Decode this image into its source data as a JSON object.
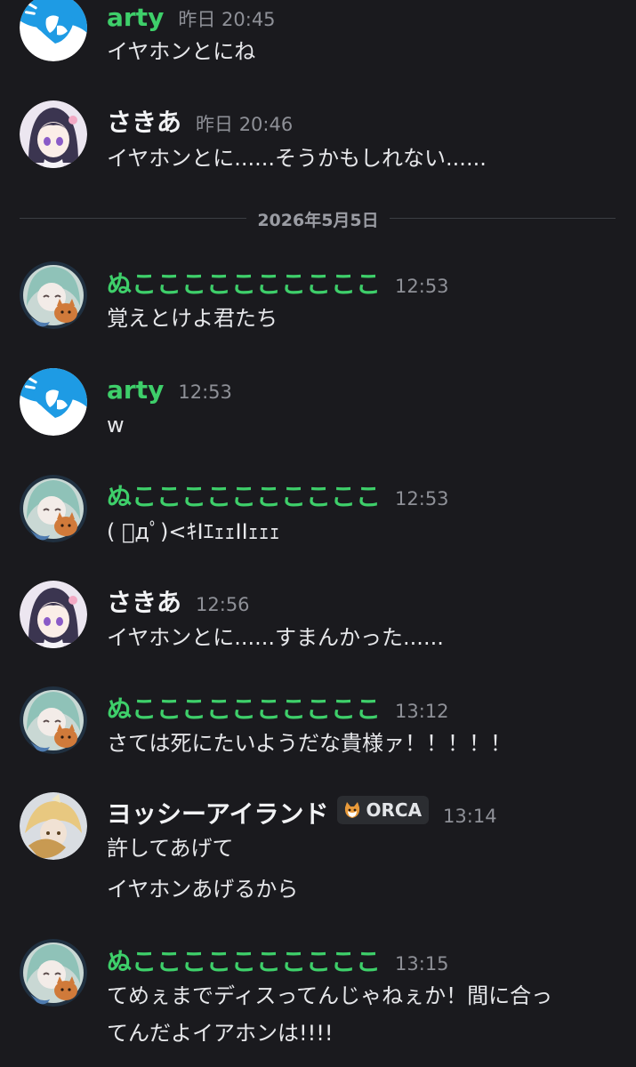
{
  "colors": {
    "background": "#1a1a1e",
    "green_name": "#3ecf6a",
    "white_name": "#f2f3f5",
    "timestamp": "#8e9097",
    "message_text": "#e6e7ea"
  },
  "date_divider": "2026年5月5日",
  "messages": [
    {
      "user": "arty",
      "time": "昨日 20:45",
      "lines": [
        "イヤホンとにね"
      ],
      "avatar": "blue-ghost-avatar"
    },
    {
      "user": "さきあ",
      "time": "昨日 20:46",
      "lines": [
        "イヤホンとに......そうかもしれない......"
      ],
      "avatar": "purple-hair-girl-avatar"
    },
    {
      "user": "ぬここここここここここ",
      "time": "12:53",
      "lines": [
        "覚えとけよ君たち"
      ],
      "avatar": "teal-hair-girl-cat-avatar"
    },
    {
      "user": "arty",
      "time": "12:53",
      "lines": [
        "w"
      ],
      "avatar": "blue-ghost-avatar"
    },
    {
      "user": "ぬここここここここここ",
      "time": "12:53",
      "lines": [
        "( ﾟдﾟ)<ｷIｴｪｪIIｪｪｪ"
      ],
      "avatar": "teal-hair-girl-cat-avatar"
    },
    {
      "user": "さきあ",
      "time": "12:56",
      "lines": [
        "イヤホンとに......すまんかった......"
      ],
      "avatar": "purple-hair-girl-avatar"
    },
    {
      "user": "ぬここここここここここ",
      "time": "13:12",
      "lines": [
        "さては死にたいようだな貴様ァ！！！！！"
      ],
      "avatar": "teal-hair-girl-cat-avatar"
    },
    {
      "user": "ヨッシーアイランド",
      "tag": "ORCA",
      "time": "13:14",
      "lines": [
        "許してあげて",
        "イヤホンあげるから"
      ],
      "avatar": "blonde-character-avatar"
    },
    {
      "user": "ぬここここここここここ",
      "time": "13:15",
      "lines": [
        "てめぇまでディスってんじゃねぇか！間に合っ",
        "てんだよイアホンは!!!!"
      ],
      "avatar": "teal-hair-girl-cat-avatar"
    }
  ]
}
